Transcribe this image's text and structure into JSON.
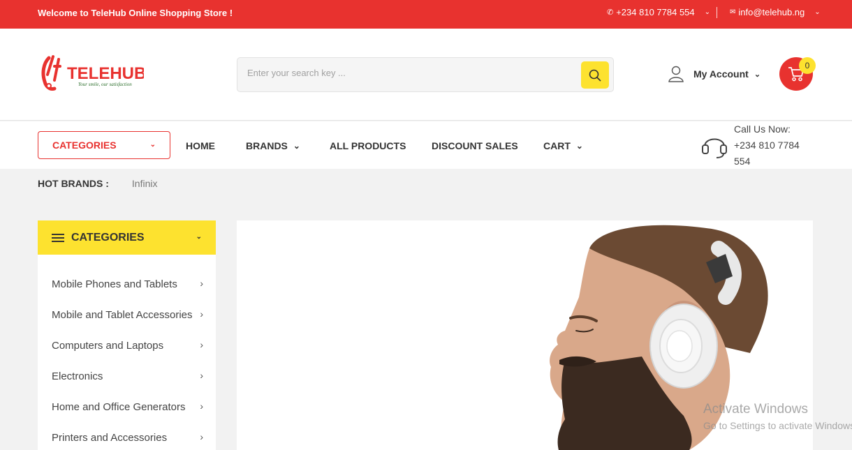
{
  "topbar": {
    "welcome": "Welcome to TeleHub Online Shopping Store !",
    "phone": "+234 810 7784 554",
    "email": "info@telehub.ng"
  },
  "header": {
    "logo_text": "TELEHUB",
    "logo_tagline": "Your smile, our satisfaction",
    "search_placeholder": "Enter your search key ...",
    "account_label": "My Account",
    "cart_count": "0"
  },
  "nav": {
    "categories_label": "CATEGORIES",
    "items": [
      "HOME",
      "BRANDS",
      "ALL PRODUCTS",
      "DISCOUNT SALES",
      "CART"
    ],
    "call_label": "Call Us Now:",
    "call_number": "+234 810 7784 554"
  },
  "hot_brands": {
    "label": "HOT BRANDS :",
    "brands": [
      "Infinix"
    ]
  },
  "sidebar": {
    "title": "CATEGORIES",
    "items": [
      "Mobile Phones and Tablets",
      "Mobile and Tablet Accessories",
      "Computers and Laptops",
      "Electronics",
      "Home and Office Generators",
      "Printers and Accessories"
    ]
  },
  "watermark": {
    "line1": "Activate Windows",
    "line2": "Go to Settings to activate Windows."
  },
  "colors": {
    "brand_red": "#e8322f",
    "brand_yellow": "#fde22f"
  }
}
